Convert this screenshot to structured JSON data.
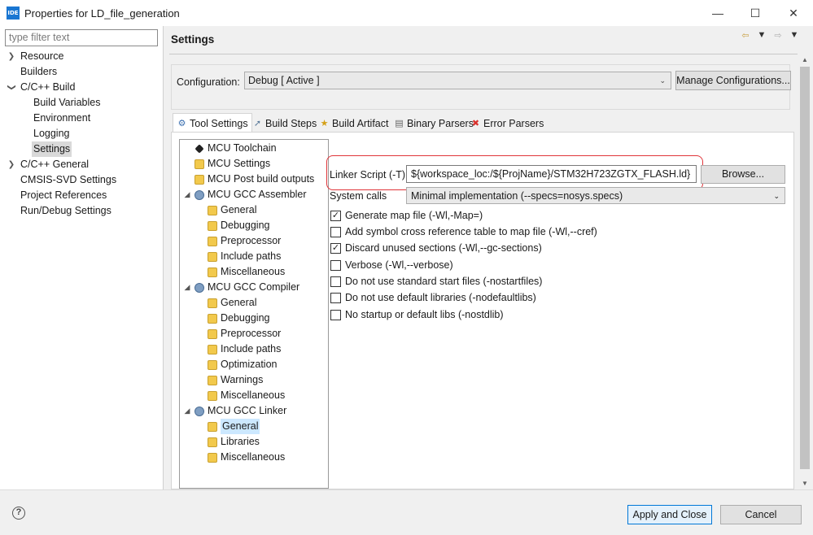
{
  "window": {
    "title": "Properties for LD_file_generation",
    "app_icon": "IDE"
  },
  "nav": {
    "filter_placeholder": "type filter text",
    "items": [
      {
        "label": "Resource"
      },
      {
        "label": "Builders"
      },
      {
        "label": "C/C++ Build"
      },
      {
        "label": "Build Variables"
      },
      {
        "label": "Environment"
      },
      {
        "label": "Logging"
      },
      {
        "label": "Settings"
      },
      {
        "label": "C/C++ General"
      },
      {
        "label": "CMSIS-SVD Settings"
      },
      {
        "label": "Project References"
      },
      {
        "label": "Run/Debug Settings"
      }
    ]
  },
  "page": {
    "title": "Settings"
  },
  "config": {
    "label": "Configuration:",
    "value": "Debug  [ Active ]",
    "manage_label": "Manage Configurations..."
  },
  "tabs": [
    {
      "label": "Tool Settings"
    },
    {
      "label": "Build Steps"
    },
    {
      "label": "Build Artifact"
    },
    {
      "label": "Binary Parsers"
    },
    {
      "label": "Error Parsers"
    }
  ],
  "tree": [
    {
      "label": "MCU Toolchain"
    },
    {
      "label": "MCU Settings"
    },
    {
      "label": "MCU Post build outputs"
    },
    {
      "label": "MCU GCC Assembler"
    },
    {
      "label": "General"
    },
    {
      "label": "Debugging"
    },
    {
      "label": "Preprocessor"
    },
    {
      "label": "Include paths"
    },
    {
      "label": "Miscellaneous"
    },
    {
      "label": "MCU GCC Compiler"
    },
    {
      "label": "General"
    },
    {
      "label": "Debugging"
    },
    {
      "label": "Preprocessor"
    },
    {
      "label": "Include paths"
    },
    {
      "label": "Optimization"
    },
    {
      "label": "Warnings"
    },
    {
      "label": "Miscellaneous"
    },
    {
      "label": "MCU GCC Linker"
    },
    {
      "label": "General"
    },
    {
      "label": "Libraries"
    },
    {
      "label": "Miscellaneous"
    }
  ],
  "linker": {
    "script_label": "Linker Script (-T)",
    "script_value": "${workspace_loc:/${ProjName}/STM32H723ZGTX_FLASH.ld}",
    "browse_label": "Browse...",
    "syscalls_label": "System calls",
    "syscalls_value": "Minimal implementation (--specs=nosys.specs)",
    "options": [
      {
        "label": "Generate map file (-Wl,-Map=)",
        "checked": true
      },
      {
        "label": "Add symbol cross reference table to map file (-Wl,--cref)",
        "checked": false
      },
      {
        "label": "Discard unused sections (-Wl,--gc-sections)",
        "checked": true
      },
      {
        "label": "Verbose (-Wl,--verbose)",
        "checked": false
      },
      {
        "label": "Do not use standard start files (-nostartfiles)",
        "checked": false
      },
      {
        "label": "Do not use default libraries (-nodefaultlibs)",
        "checked": false
      },
      {
        "label": "No startup or default libs (-nostdlib)",
        "checked": false
      }
    ],
    "check_mark": "✓"
  },
  "buttons": {
    "apply_close": "Apply and Close",
    "cancel": "Cancel",
    "help": "?"
  },
  "colors": {
    "highlight_ring": "#e0353a",
    "selection": "#cce8ff",
    "primary_border": "#0078d7"
  }
}
